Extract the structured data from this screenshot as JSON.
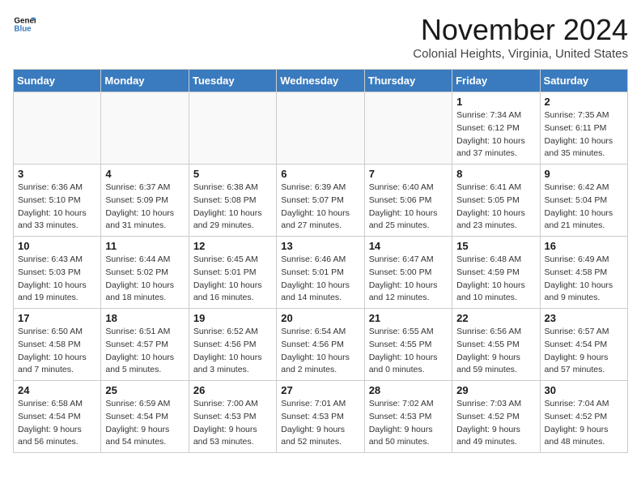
{
  "header": {
    "logo_text_general": "General",
    "logo_text_blue": "Blue",
    "month_title": "November 2024",
    "subtitle": "Colonial Heights, Virginia, United States"
  },
  "calendar": {
    "weekdays": [
      "Sunday",
      "Monday",
      "Tuesday",
      "Wednesday",
      "Thursday",
      "Friday",
      "Saturday"
    ],
    "weeks": [
      [
        {
          "day": "",
          "detail": ""
        },
        {
          "day": "",
          "detail": ""
        },
        {
          "day": "",
          "detail": ""
        },
        {
          "day": "",
          "detail": ""
        },
        {
          "day": "",
          "detail": ""
        },
        {
          "day": "1",
          "detail": "Sunrise: 7:34 AM\nSunset: 6:12 PM\nDaylight: 10 hours and 37 minutes."
        },
        {
          "day": "2",
          "detail": "Sunrise: 7:35 AM\nSunset: 6:11 PM\nDaylight: 10 hours and 35 minutes."
        }
      ],
      [
        {
          "day": "3",
          "detail": "Sunrise: 6:36 AM\nSunset: 5:10 PM\nDaylight: 10 hours and 33 minutes."
        },
        {
          "day": "4",
          "detail": "Sunrise: 6:37 AM\nSunset: 5:09 PM\nDaylight: 10 hours and 31 minutes."
        },
        {
          "day": "5",
          "detail": "Sunrise: 6:38 AM\nSunset: 5:08 PM\nDaylight: 10 hours and 29 minutes."
        },
        {
          "day": "6",
          "detail": "Sunrise: 6:39 AM\nSunset: 5:07 PM\nDaylight: 10 hours and 27 minutes."
        },
        {
          "day": "7",
          "detail": "Sunrise: 6:40 AM\nSunset: 5:06 PM\nDaylight: 10 hours and 25 minutes."
        },
        {
          "day": "8",
          "detail": "Sunrise: 6:41 AM\nSunset: 5:05 PM\nDaylight: 10 hours and 23 minutes."
        },
        {
          "day": "9",
          "detail": "Sunrise: 6:42 AM\nSunset: 5:04 PM\nDaylight: 10 hours and 21 minutes."
        }
      ],
      [
        {
          "day": "10",
          "detail": "Sunrise: 6:43 AM\nSunset: 5:03 PM\nDaylight: 10 hours and 19 minutes."
        },
        {
          "day": "11",
          "detail": "Sunrise: 6:44 AM\nSunset: 5:02 PM\nDaylight: 10 hours and 18 minutes."
        },
        {
          "day": "12",
          "detail": "Sunrise: 6:45 AM\nSunset: 5:01 PM\nDaylight: 10 hours and 16 minutes."
        },
        {
          "day": "13",
          "detail": "Sunrise: 6:46 AM\nSunset: 5:01 PM\nDaylight: 10 hours and 14 minutes."
        },
        {
          "day": "14",
          "detail": "Sunrise: 6:47 AM\nSunset: 5:00 PM\nDaylight: 10 hours and 12 minutes."
        },
        {
          "day": "15",
          "detail": "Sunrise: 6:48 AM\nSunset: 4:59 PM\nDaylight: 10 hours and 10 minutes."
        },
        {
          "day": "16",
          "detail": "Sunrise: 6:49 AM\nSunset: 4:58 PM\nDaylight: 10 hours and 9 minutes."
        }
      ],
      [
        {
          "day": "17",
          "detail": "Sunrise: 6:50 AM\nSunset: 4:58 PM\nDaylight: 10 hours and 7 minutes."
        },
        {
          "day": "18",
          "detail": "Sunrise: 6:51 AM\nSunset: 4:57 PM\nDaylight: 10 hours and 5 minutes."
        },
        {
          "day": "19",
          "detail": "Sunrise: 6:52 AM\nSunset: 4:56 PM\nDaylight: 10 hours and 3 minutes."
        },
        {
          "day": "20",
          "detail": "Sunrise: 6:54 AM\nSunset: 4:56 PM\nDaylight: 10 hours and 2 minutes."
        },
        {
          "day": "21",
          "detail": "Sunrise: 6:55 AM\nSunset: 4:55 PM\nDaylight: 10 hours and 0 minutes."
        },
        {
          "day": "22",
          "detail": "Sunrise: 6:56 AM\nSunset: 4:55 PM\nDaylight: 9 hours and 59 minutes."
        },
        {
          "day": "23",
          "detail": "Sunrise: 6:57 AM\nSunset: 4:54 PM\nDaylight: 9 hours and 57 minutes."
        }
      ],
      [
        {
          "day": "24",
          "detail": "Sunrise: 6:58 AM\nSunset: 4:54 PM\nDaylight: 9 hours and 56 minutes."
        },
        {
          "day": "25",
          "detail": "Sunrise: 6:59 AM\nSunset: 4:54 PM\nDaylight: 9 hours and 54 minutes."
        },
        {
          "day": "26",
          "detail": "Sunrise: 7:00 AM\nSunset: 4:53 PM\nDaylight: 9 hours and 53 minutes."
        },
        {
          "day": "27",
          "detail": "Sunrise: 7:01 AM\nSunset: 4:53 PM\nDaylight: 9 hours and 52 minutes."
        },
        {
          "day": "28",
          "detail": "Sunrise: 7:02 AM\nSunset: 4:53 PM\nDaylight: 9 hours and 50 minutes."
        },
        {
          "day": "29",
          "detail": "Sunrise: 7:03 AM\nSunset: 4:52 PM\nDaylight: 9 hours and 49 minutes."
        },
        {
          "day": "30",
          "detail": "Sunrise: 7:04 AM\nSunset: 4:52 PM\nDaylight: 9 hours and 48 minutes."
        }
      ]
    ]
  }
}
